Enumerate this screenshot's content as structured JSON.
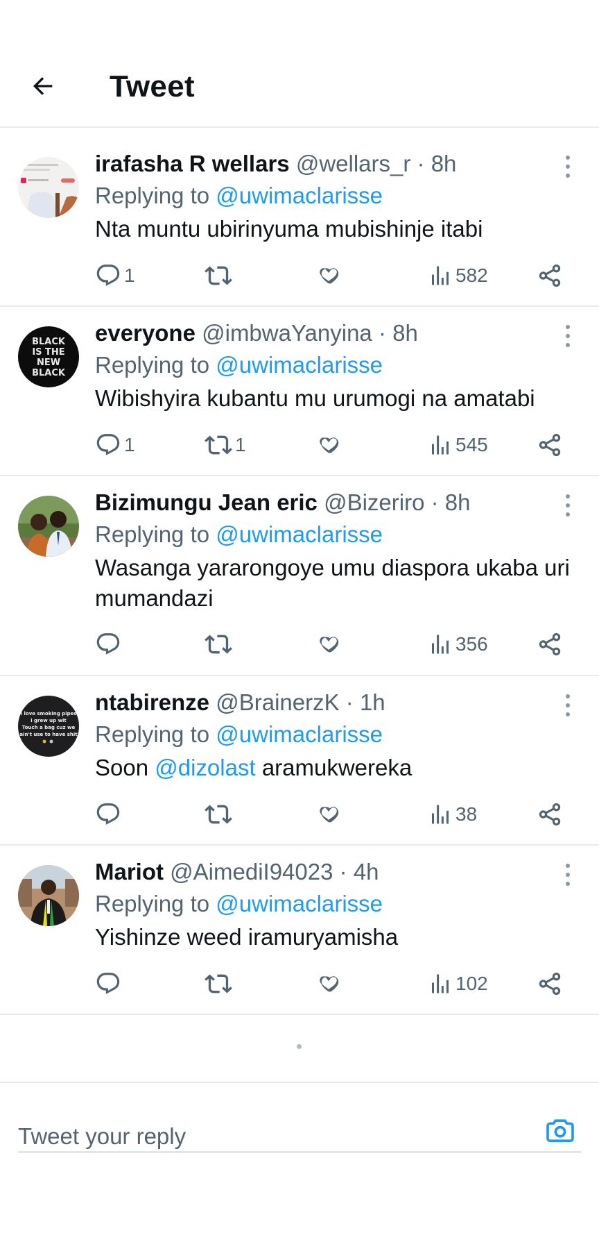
{
  "header": {
    "title": "Tweet"
  },
  "tweets": [
    {
      "name": "irafasha R wellars",
      "handle": "@wellars_r",
      "time": "· 8h",
      "replying_prefix": "Replying to",
      "replying_to": "@uwimaclarisse",
      "text": "Nta muntu ubirinyuma mubishinje itabi",
      "replies": "1",
      "retweets": "",
      "views": "582"
    },
    {
      "name": "everyone",
      "handle": "@imbwaYanyina",
      "time": "· 8h",
      "replying_prefix": "Replying to",
      "replying_to": "@uwimaclarisse",
      "text": "Wibishyira kubantu mu urumogi na amatabi",
      "replies": "1",
      "retweets": "1",
      "views": "545",
      "avatar_text": "BLACK IS THE NEW BLACK"
    },
    {
      "name": "Bizimungu Jean eric",
      "handle": "@Bizeriro",
      "time": "· 8h",
      "replying_prefix": "Replying to",
      "replying_to": "@uwimaclarisse",
      "text": "Wasanga yararongoye umu diaspora ukaba uri mumandazi",
      "replies": "",
      "retweets": "",
      "views": "356"
    },
    {
      "name": "ntabirenze",
      "handle": "@BrainerzK",
      "time": "· 1h",
      "replying_prefix": "Replying to",
      "replying_to": "@uwimaclarisse",
      "text_before": "Soon",
      "text_mention": "@dizolast",
      "text_after": "aramukwereka",
      "replies": "",
      "retweets": "",
      "views": "38",
      "avatar_text": "I love smoking pipes i grew up wit Touch a bag cuz we ain't use to have shit"
    },
    {
      "name": "Mariot",
      "handle": "@AimediI94023",
      "time": "· 4h",
      "replying_prefix": "Replying to",
      "replying_to": "@uwimaclarisse",
      "text": "Yishinze weed iramuryamisha",
      "replies": "",
      "retweets": "",
      "views": "102"
    }
  ],
  "composer": {
    "placeholder": "Tweet your reply"
  },
  "colors": {
    "accent": "#1d9bf0",
    "muted": "#536471",
    "text": "#0f1419",
    "divider": "#e6eaed"
  },
  "icons": [
    "back-arrow-icon",
    "more-vertical-icon",
    "reply-icon",
    "retweet-icon",
    "like-icon",
    "views-icon",
    "share-icon",
    "camera-icon"
  ]
}
